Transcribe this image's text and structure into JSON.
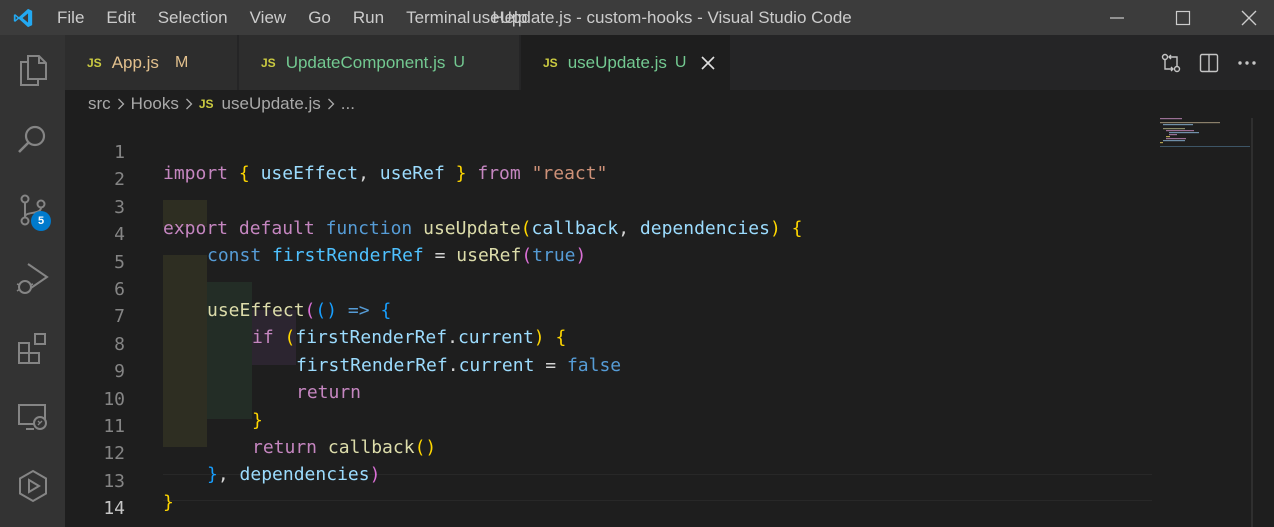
{
  "window": {
    "title": "useUpdate.js - custom-hooks - Visual Studio Code",
    "menu": [
      "File",
      "Edit",
      "Selection",
      "View",
      "Go",
      "Run",
      "Terminal",
      "Help"
    ]
  },
  "activity_bar": {
    "items": [
      "explorer-icon",
      "search-icon",
      "source-control-icon",
      "run-debug-icon",
      "extensions-icon",
      "remote-explorer-icon",
      "timeline-icon"
    ],
    "source_control_badge": "5"
  },
  "tabs": [
    {
      "icon": "JS",
      "name": "App.js",
      "status": "M",
      "name_color": "#e2c08d",
      "active": false
    },
    {
      "icon": "JS",
      "name": "UpdateComponent.js",
      "status": "U",
      "name_color": "#73c991",
      "active": false
    },
    {
      "icon": "JS",
      "name": "useUpdate.js",
      "status": "U",
      "name_color": "#73c991",
      "active": true
    }
  ],
  "breadcrumb": {
    "segments": [
      "src",
      "Hooks"
    ],
    "file_icon": "JS",
    "file": "useUpdate.js",
    "tail": "..."
  },
  "editor": {
    "current_line": 14,
    "lines": [
      {
        "n": "1"
      },
      {
        "n": "2"
      },
      {
        "n": "3"
      },
      {
        "n": "4"
      },
      {
        "n": "5"
      },
      {
        "n": "6"
      },
      {
        "n": "7"
      },
      {
        "n": "8"
      },
      {
        "n": "9"
      },
      {
        "n": "10"
      },
      {
        "n": "11"
      },
      {
        "n": "12"
      },
      {
        "n": "13"
      },
      {
        "n": "14"
      }
    ],
    "tokens": {
      "l1": [
        "import",
        "{",
        "useEffect",
        ",",
        "useRef",
        "}",
        "from",
        "\"react\""
      ],
      "l3": [
        "export",
        "default",
        "function",
        "useUpdate",
        "(",
        "callback",
        ",",
        "dependencies",
        ")",
        "{"
      ],
      "l4": [
        "const",
        "firstRenderRef",
        "=",
        "useRef",
        "(",
        "true",
        ")"
      ],
      "l6": [
        "useEffect",
        "(",
        "(",
        ")",
        "=>",
        "{"
      ],
      "l7": [
        "if",
        "(",
        "firstRenderRef",
        ".",
        "current",
        ")",
        "{"
      ],
      "l8": [
        "firstRenderRef",
        ".",
        "current",
        "=",
        "false"
      ],
      "l9": [
        "return"
      ],
      "l10": [
        "}"
      ],
      "l11": [
        "return",
        "callback",
        "(",
        ")"
      ],
      "l12": [
        "}",
        ",",
        "dependencies",
        ")"
      ],
      "l13": [
        "}"
      ]
    }
  },
  "colors": {
    "titlebar": "#3c3c3c",
    "activitybar": "#333333",
    "editor_bg": "#1e1e1e",
    "badge": "#007acc",
    "modified": "#e2c08d",
    "untracked": "#73c991"
  }
}
